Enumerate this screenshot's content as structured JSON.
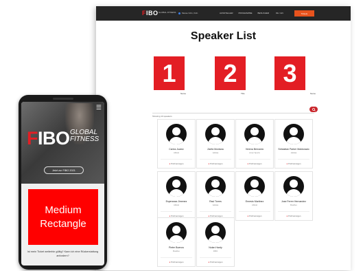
{
  "desktop": {
    "nav": {
      "logo": "FIBO",
      "logo_sub": "GLOBAL FITNESS",
      "location": "Messe Köln, Köln",
      "links": [
        "AUSSTELLER",
        "PROGRAMME",
        "BESUCHER"
      ],
      "language": "DE / EN",
      "ticket_label": "Tickets"
    },
    "page_title": "Speaker List",
    "featured": [
      {
        "number": "1",
        "caption": "Name"
      },
      {
        "number": "2",
        "caption": "Title"
      },
      {
        "number": "3",
        "caption": "Name"
      }
    ],
    "search_icon": "search-icon",
    "results_text": "Showing 10 speakers",
    "speakers": [
      {
        "name": "Carlos Juarez",
        "company": "Abbott",
        "link": "Profil anzeigen"
      },
      {
        "name": "Zarifa Montana",
        "company": "Adidas",
        "link": "Profil anzeigen"
      },
      {
        "name": "Verena Bernardo",
        "company": "Amer Sports",
        "link": "Profil anzeigen"
      },
      {
        "name": "Sebastian Parker Maldonado",
        "company": "Adidas",
        "link": "Profil anzeigen"
      },
      {
        "name": "Esperanza Jimenez",
        "company": "Abbott",
        "link": "Profil anzeigen"
      },
      {
        "name": "Raul Torres",
        "company": "Adidas",
        "link": "Profil anzeigen"
      },
      {
        "name": "Ernesto Martinez",
        "company": "Abbott",
        "link": "Profil anzeigen"
      },
      {
        "name": "Jose Ferrer Hernandez",
        "company": "Bowflex",
        "link": "Profil anzeigen"
      },
      {
        "name": "Pieter Buenos",
        "company": "Bowflex",
        "link": "Profil anzeigen"
      },
      {
        "name": "Nolan Hardy",
        "company": "FIBO",
        "link": "Profil anzeigen"
      }
    ]
  },
  "phone": {
    "menu_icon": "hamburger-menu-icon",
    "logo": "FIBO",
    "logo_global": "GLOBAL",
    "logo_fitness": "FITNESS",
    "cta_label": "Jetzt zur FIBO 2021",
    "ad_line1": "Medium",
    "ad_line2": "Rectangle",
    "faq_text": "Ist mein Ticket weiterhin gültig? Kann ich eine Rückerstattung anfordern?"
  },
  "colors": {
    "brand_red": "#e31e24",
    "ad_red": "#ff0000",
    "nav_dark": "#262626",
    "ticket_orange": "#e8531d"
  }
}
